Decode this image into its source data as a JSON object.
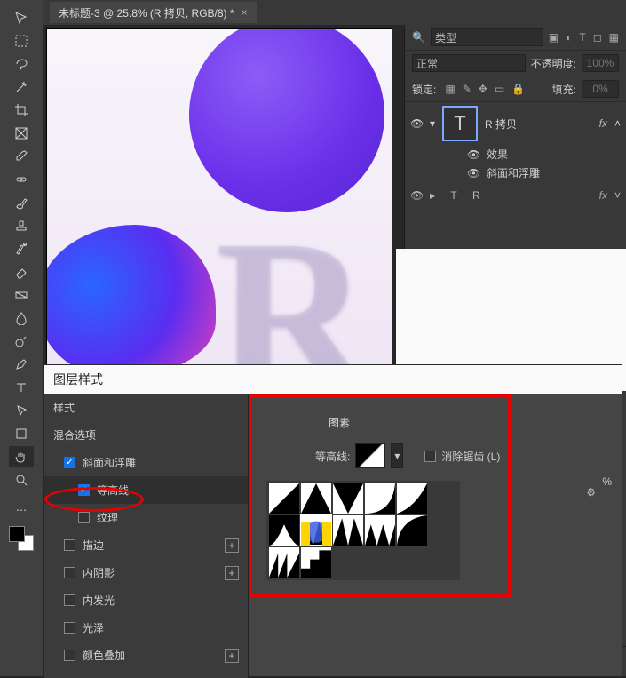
{
  "doc_tab": {
    "title": "未标题-3 @ 25.8% (R 拷贝, RGB/8) *",
    "close": "×"
  },
  "rightpanel": {
    "search_icon": "🔍",
    "type_label": "类型",
    "blend_mode": "正常",
    "opacity_label": "不透明度:",
    "opacity_value": "100%",
    "lock_label": "锁定:",
    "fill_label": "填充:",
    "fill_value": "0%",
    "layer1_name": "R 拷贝",
    "fx_label": "fx",
    "sub_effects": "效果",
    "sub_bevel": "斜面和浮雕",
    "layer2_name": "R"
  },
  "dialog": {
    "title": "图层样式",
    "items": {
      "styles": "样式",
      "blending": "混合选项",
      "bevel": "斜面和浮雕",
      "contour": "等高线",
      "texture": "纹理",
      "stroke": "描边",
      "inner_shadow": "内阴影",
      "inner_glow": "内发光",
      "satin": "光泽",
      "color_overlay": "颜色叠加"
    },
    "right": {
      "section": "图素",
      "contour_label": "等高线:",
      "antialias": "消除锯齿 (L)",
      "percent": "%"
    }
  },
  "tool_tips": {
    "move": "move-tool",
    "marquee": "marquee-tool",
    "lasso": "lasso-tool",
    "wand": "wand-tool",
    "crop": "crop-tool",
    "frame": "frame-tool",
    "eyedropper": "eyedropper-tool",
    "heal": "heal-tool",
    "brush": "brush-tool",
    "stamp": "stamp-tool",
    "history": "history-brush-tool",
    "eraser": "eraser-tool",
    "gradient": "gradient-tool",
    "blur": "blur-tool",
    "dodge": "dodge-tool",
    "pen": "pen-tool",
    "type": "type-tool",
    "path": "path-select-tool",
    "shape": "shape-tool",
    "hand": "hand-tool",
    "zoom": "zoom-tool"
  }
}
